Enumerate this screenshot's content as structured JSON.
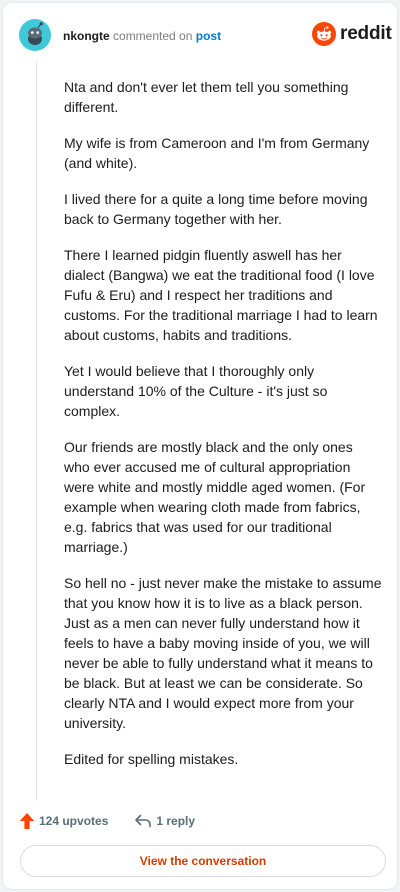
{
  "header": {
    "username": "nkongte",
    "action_text": "commented on",
    "post_link": "post",
    "avatar_icon": "snoo-avatar-icon",
    "brand_icon": "reddit-alien-icon",
    "brand_name": "reddit"
  },
  "comment": {
    "paragraphs": [
      "Nta and don't ever let them tell you something different.",
      "My wife is from Cameroon and I'm from Germany (and white).",
      "I lived there for a quite a long time before moving back to Germany together with her.",
      "There I learned pidgin fluently aswell has her dialect (Bangwa) we eat the traditional food (I love Fufu & Eru) and I respect her traditions and customs. For the traditional marriage I had to learn about customs, habits and traditions.",
      "Yet I would believe that I thoroughly only understand 10% of the Culture - it's just so complex.",
      "Our friends are mostly black and the only ones who ever accused me of cultural appropriation were white and mostly middle aged women. (For example when wearing cloth made from fabrics, e.g. fabrics that was used for our traditional marriage.)",
      "So hell no - just never make the mistake to assume that you know how it is to live as a black person. Just as a men can never fully understand how it feels to have a baby moving inside of you, we will never be able to fully understand what it means to be black. But at least we can be considerate. So clearly NTA and I would expect more from your university.",
      "Edited for spelling mistakes."
    ]
  },
  "actions": {
    "upvotes": "124 upvotes",
    "upvote_icon": "upvote-arrow-icon",
    "replies": "1 reply",
    "reply_icon": "reply-arrow-icon"
  },
  "cta": {
    "label": "View the conversation"
  },
  "colors": {
    "brand": "#ff4500",
    "link": "#0079d3",
    "cta_text": "#d93a00",
    "avatar": "#3fc8d9"
  }
}
